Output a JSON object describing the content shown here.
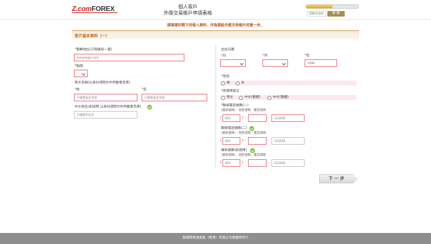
{
  "header": {
    "logo_z": "Z.com",
    "logo_forex": "FOREX",
    "title_line1": "個人客戶",
    "title_line2": "外匯交易帳戶申請表格",
    "progress_fraction": 0.5,
    "lang_english": "ENGLISH",
    "lang_chinese": "繁 體"
  },
  "notice": "請填寫好閣下的個人資料、作為開設外匯交易帳戶的第一步。",
  "section_title": "客戶基本資料（一）",
  "left": {
    "email_label": "電郵地址(只限填寫一個)",
    "email_placeholder": "sample@a.com",
    "title_label": "稱謂",
    "english_name_label": "英文名稱(以身份證明文件所載者為準)",
    "surname_label": "姓",
    "surname_placeholder": "只接受英文字母",
    "given_label": "名",
    "given_placeholder": "只接受英文字母",
    "chinese_name_label": "中文姓名(如適用,以身份證明文件所載者為準)",
    "chinese_name_placeholder": "只接受中文字"
  },
  "right": {
    "dob_label": "出生日期",
    "day_label": "日",
    "month_label": "月",
    "year_label": "年",
    "year_placeholder": "1980",
    "gender_label": "性別",
    "gender_options": [
      "男",
      "女"
    ],
    "language_label": "請選擇語言",
    "language_options": [
      "英文",
      "中文(繁體)",
      "中文(簡體)"
    ],
    "phone1_label": "聯絡電話號碼(一)",
    "phone1_sub": "(國家號碼) - 地區號碼 - 電話號碼",
    "phone2_label": "聯絡電話號碼(二)",
    "phone2_sub": "(國家號碼) - 地區號碼 - 電話號碼",
    "fax_label": "傳真號碼(如適用)",
    "fax_sub": "(國家號碼) - 地區號碼 - 電話號碼",
    "country_placeholder": "852",
    "number_placeholder": "123456",
    "open_paren": "(",
    "close_paren": ")",
    "dash": "-"
  },
  "next_button": "下 一 步",
  "footer": "版權環球通金融（香港）有限公司版權所有©"
}
